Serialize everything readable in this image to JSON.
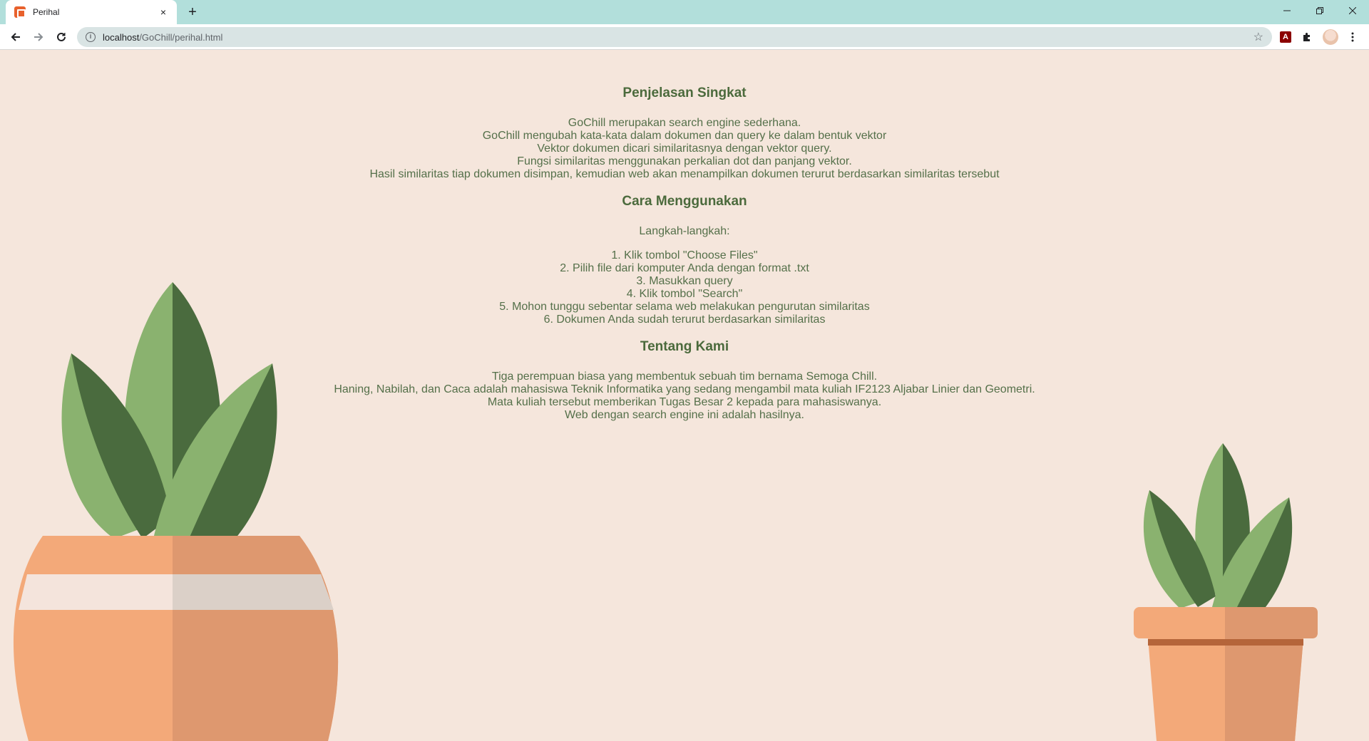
{
  "browser": {
    "tab_title": "Perihal",
    "tab_close": "×",
    "new_tab": "+",
    "url_host": "localhost",
    "url_path": "/GoChill/perihal.html",
    "icons": [
      "back-icon",
      "forward-icon",
      "reload-icon",
      "info-icon",
      "star-icon",
      "pdf-extension-icon",
      "puzzle-extension-icon",
      "profile-avatar",
      "menu-icon",
      "minimize-icon",
      "restore-icon",
      "close-window-icon"
    ]
  },
  "sections": {
    "summary": {
      "title": "Penjelasan Singkat",
      "lines": [
        "GoChill merupakan search engine sederhana.",
        "GoChill mengubah kata-kata dalam dokumen dan query ke dalam bentuk vektor",
        "Vektor dokumen dicari similaritasnya dengan vektor query.",
        "Fungsi similaritas menggunakan perkalian dot dan panjang vektor.",
        "Hasil similaritas tiap dokumen disimpan, kemudian web akan menampilkan dokumen terurut berdasarkan similaritas tersebut"
      ]
    },
    "howto": {
      "title": "Cara Menggunakan",
      "subtitle": "Langkah-langkah:",
      "steps": [
        "1. Klik tombol \"Choose Files\"",
        "2. Pilih file dari komputer Anda dengan format .txt",
        "3. Masukkan query",
        "4. Klik tombol \"Search\"",
        "5. Mohon tunggu sebentar selama web melakukan pengurutan similaritas",
        "6. Dokumen Anda sudah terurut berdasarkan similaritas"
      ]
    },
    "about": {
      "title": "Tentang Kami",
      "lines": [
        "Tiga perempuan biasa yang membentuk sebuah tim bernama Semoga Chill.",
        "Haning, Nabilah, dan Caca adalah mahasiswa Teknik Informatika yang sedang mengambil mata kuliah IF2123 Aljabar Linier dan Geometri.",
        "Mata kuliah tersebut memberikan Tugas Besar 2 kepada para mahasiswanya.",
        "Web dengan search engine ini adalah hasilnya."
      ]
    }
  },
  "colors": {
    "page_background": "#f5e6dc",
    "heading_green": "#4b6a3c",
    "tab_bar": "#b2dfdb",
    "leaf_light": "#8ab26f",
    "leaf_dark": "#4a6b3e",
    "pot_light": "#f3a979",
    "pot_dark": "#de986f"
  }
}
